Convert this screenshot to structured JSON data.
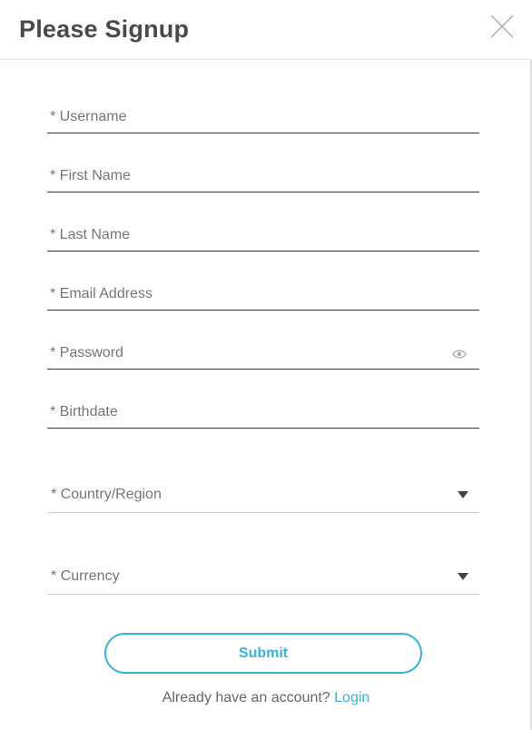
{
  "modal": {
    "title": "Please Signup",
    "close_icon": "close-icon"
  },
  "form": {
    "username_placeholder": "* Username",
    "first_name_placeholder": "* First Name",
    "last_name_placeholder": "* Last Name",
    "email_placeholder": "* Email Address",
    "password_placeholder": "* Password",
    "password_toggle_icon": "eye-icon",
    "birthdate_placeholder": "* Birthdate",
    "country_label": "* Country/Region",
    "currency_label": "* Currency",
    "dropdown_icon": "caret-down-icon",
    "submit_label": "Submit"
  },
  "footer": {
    "prompt": "Already have an account?",
    "login_label": "Login"
  },
  "colors": {
    "accent": "#3bb1d6",
    "title": "#4a4a4a",
    "placeholder": "#757575"
  }
}
